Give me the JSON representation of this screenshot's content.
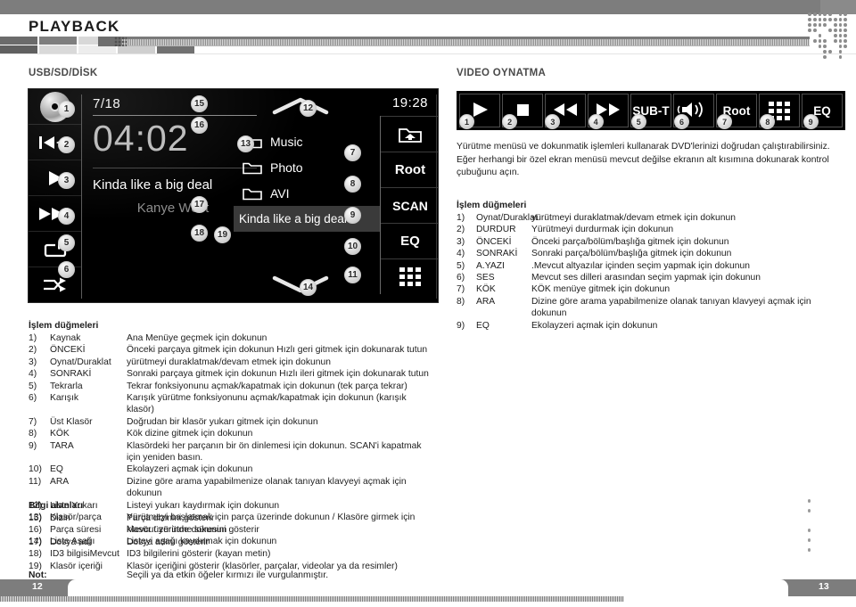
{
  "header": {
    "chapter_title": "PLAYBACK",
    "tab_colors": [
      "#6b6b6b",
      "#7e7e7e",
      "#d8d8d8",
      "#bdbdbd",
      "#9e9e9e"
    ]
  },
  "sections": {
    "usb_label": "USB/SD/DİSK",
    "video_label": "VIDEO OYNATMA"
  },
  "device_screen": {
    "track_index": "7/18",
    "elapsed_time": "04:02",
    "track_title": "Kinda like a big deal",
    "artist": "Kanye West",
    "clock": "19:28",
    "transport": [
      {
        "callout": "1",
        "icon": "disc-icon"
      },
      {
        "callout": "2",
        "icon": "previous-track-icon"
      },
      {
        "callout": "3",
        "icon": "play-icon"
      },
      {
        "callout": "4",
        "icon": "next-track-icon"
      },
      {
        "callout": "5",
        "icon": "repeat-icon"
      },
      {
        "callout": "6",
        "icon": "shuffle-icon"
      }
    ],
    "list": [
      {
        "callout": "13",
        "label": "Music",
        "icon": "folder-icon",
        "selected": false
      },
      {
        "callout": "",
        "label": "Photo",
        "icon": "folder-icon",
        "selected": false
      },
      {
        "callout": "",
        "label": "AVI",
        "icon": "folder-icon",
        "selected": false
      },
      {
        "callout": "19",
        "label": "Kinda like a big deal",
        "icon": "track-icon",
        "selected": true
      }
    ],
    "scroll_up_callout": "12",
    "scroll_down_callout": "14",
    "actions": [
      {
        "callout": "7",
        "label": "",
        "icon": "up-folder-icon"
      },
      {
        "callout": "8",
        "label": "Root",
        "icon": "text-icon"
      },
      {
        "callout": "9",
        "label": "SCAN",
        "icon": "text-icon"
      },
      {
        "callout": "10",
        "label": "EQ",
        "icon": "text-icon"
      },
      {
        "callout": "11",
        "label": "",
        "icon": "keypad-grid-icon"
      }
    ],
    "info_callouts": [
      "15",
      "16",
      "17",
      "18"
    ]
  },
  "video_bar": [
    {
      "callout": "1",
      "label": "",
      "icon": "play-icon"
    },
    {
      "callout": "2",
      "label": "",
      "icon": "stop-icon"
    },
    {
      "callout": "3",
      "label": "",
      "icon": "rewind-icon"
    },
    {
      "callout": "4",
      "label": "",
      "icon": "fast-forward-icon"
    },
    {
      "callout": "5",
      "label": "SUB-T",
      "icon": "text-icon"
    },
    {
      "callout": "6",
      "label": "",
      "icon": "audio-speaker-icon"
    },
    {
      "callout": "7",
      "label": "Root",
      "icon": "text-icon"
    },
    {
      "callout": "8",
      "label": "",
      "icon": "keypad-grid-icon"
    },
    {
      "callout": "9",
      "label": "EQ",
      "icon": "text-icon"
    }
  ],
  "video_intro": "Yürütme menüsü ve dokunmatik işlemleri kullanarak DVD'lerinizi doğrudan çalıştırabilirsiniz. Eğer herhangi bir özel ekran menüsü mevcut değilse ekranın alt kısımına dokunarak kontrol çubuğunu açın.",
  "video_ops": {
    "heading": "İşlem düğmeleri",
    "rows": [
      {
        "num": "1)",
        "name": "Oynat/Duraklat",
        "desc": "yürütmeyi duraklatmak/devam etmek için dokunun"
      },
      {
        "num": "2)",
        "name": "DURDUR",
        "desc": "Yürütmeyi durdurmak için dokunun"
      },
      {
        "num": "3)",
        "name": "ÖNCEKİ",
        "desc": "Önceki parça/bölüm/başlığa gitmek için dokunun"
      },
      {
        "num": "4)",
        "name": "SONRAKİ",
        "desc": "Sonraki parça/bölüm/başlığa gitmek için dokunun"
      },
      {
        "num": "5)",
        "name": "A.YAZI",
        "desc": ".Mevcut altyazılar içinden seçim yapmak için dokunun"
      },
      {
        "num": "6)",
        "name": "SES",
        "desc": "Mevcut ses dilleri arasından seçim yapmak için dokunun"
      },
      {
        "num": "7)",
        "name": "KÖK",
        "desc": "KÖK menüye gitmek için dokunun"
      },
      {
        "num": "8)",
        "name": "ARA",
        "desc": "Dizine göre arama yapabilmenize olanak tanıyan klavyeyi açmak için dokunun"
      },
      {
        "num": "9)",
        "name": "EQ",
        "desc": "Ekolayzeri açmak için dokunun"
      }
    ]
  },
  "audio_ops": {
    "heading": "İşlem düğmeleri",
    "rows": [
      {
        "num": "1)",
        "name": "Kaynak",
        "desc": "Ana Menüye geçmek için dokunun"
      },
      {
        "num": "2)",
        "name": "ÖNCEKİ",
        "desc": "Önceki parçaya gitmek için dokunun Hızlı geri gitmek için dokunarak tutun"
      },
      {
        "num": "3)",
        "name": "Oynat/Duraklat",
        "desc": "yürütmeyi duraklatmak/devam etmek için dokunun"
      },
      {
        "num": "4)",
        "name": "SONRAKİ",
        "desc": "Sonraki parçaya gitmek için dokunun Hızlı ileri gitmek için dokunarak tutun"
      },
      {
        "num": "5)",
        "name": "Tekrarla",
        "desc": "Tekrar fonksiyonunu açmak/kapatmak için dokunun (tek parça tekrar)"
      },
      {
        "num": "6)",
        "name": "Karışık",
        "desc": "Karışık yürütme fonksiyonunu açmak/kapatmak için dokunun (karışık klasör)"
      },
      {
        "num": "7)",
        "name": "Üst Klasör",
        "desc": "Doğrudan bir klasör yukarı gitmek için dokunun"
      },
      {
        "num": "8)",
        "name": "KÖK",
        "desc": "Kök dizine gitmek için dokunun"
      },
      {
        "num": "9)",
        "name": "TARA",
        "desc": "Klasördeki her parçanın bir ön dinlemesi için dokunun. SCAN'i kapatmak için yeniden basın."
      },
      {
        "num": "10)",
        "name": "EQ",
        "desc": "Ekolayzeri açmak için dokunun"
      },
      {
        "num": "11)",
        "name": "ARA",
        "desc": "Dizine göre arama yapabilmenize olanak tanıyan klavyeyi açmak için dokunun"
      },
      {
        "num": "12)",
        "name": "Liste Yukarı",
        "desc": "Listeyi yukarı kaydırmak için dokunun"
      },
      {
        "num": "13)",
        "name": "Klasör/parça",
        "desc": "Yürütmeyi başlatmak için parça üzerinde dokunun / Klasöre girmek için klasör üzerinde dokunun"
      },
      {
        "num": "14)",
        "name": "Liste Aşağı",
        "desc": "Listeyi aşağı kaydırmak için dokunun"
      }
    ]
  },
  "info_fields": {
    "heading": "Bilgi alanları",
    "rows": [
      {
        "num": "15)",
        "name": "Dizin",
        "desc": "Parça dizinini gösterir"
      },
      {
        "num": "16)",
        "name": "Parça süresi",
        "desc": "Mevcut yürütme süresini gösterir"
      },
      {
        "num": "17)",
        "name": "Dosya adı",
        "desc": "Dosya adını gösterir"
      },
      {
        "num": "18)",
        "name": "ID3 bilgisiMevcut",
        "desc": "ID3 bilgilerini gösterir (kayan metin)"
      },
      {
        "num": "19)",
        "name": "Klasör içeriği",
        "desc": "Klasör içeriğini gösterir (klasörler, parçalar, videolar ya da resimler)"
      }
    ]
  },
  "note": {
    "label": "Not:",
    "text": "Seçili ya da etkin öğeler kırmızı ile vurgulanmıştır."
  },
  "footer": {
    "page_left": "12",
    "page_right": "13"
  }
}
